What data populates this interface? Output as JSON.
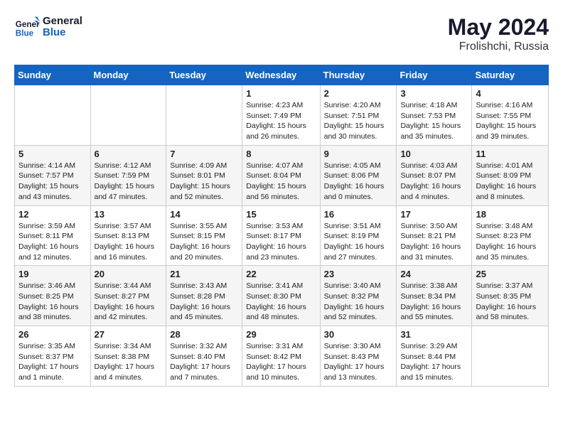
{
  "header": {
    "logo_line1": "General",
    "logo_line2": "Blue",
    "main_title": "May 2024",
    "subtitle": "Frolishchi, Russia"
  },
  "days_of_week": [
    "Sunday",
    "Monday",
    "Tuesday",
    "Wednesday",
    "Thursday",
    "Friday",
    "Saturday"
  ],
  "weeks": [
    [
      {
        "num": "",
        "detail": ""
      },
      {
        "num": "",
        "detail": ""
      },
      {
        "num": "",
        "detail": ""
      },
      {
        "num": "1",
        "detail": "Sunrise: 4:23 AM\nSunset: 7:49 PM\nDaylight: 15 hours\nand 26 minutes."
      },
      {
        "num": "2",
        "detail": "Sunrise: 4:20 AM\nSunset: 7:51 PM\nDaylight: 15 hours\nand 30 minutes."
      },
      {
        "num": "3",
        "detail": "Sunrise: 4:18 AM\nSunset: 7:53 PM\nDaylight: 15 hours\nand 35 minutes."
      },
      {
        "num": "4",
        "detail": "Sunrise: 4:16 AM\nSunset: 7:55 PM\nDaylight: 15 hours\nand 39 minutes."
      }
    ],
    [
      {
        "num": "5",
        "detail": "Sunrise: 4:14 AM\nSunset: 7:57 PM\nDaylight: 15 hours\nand 43 minutes."
      },
      {
        "num": "6",
        "detail": "Sunrise: 4:12 AM\nSunset: 7:59 PM\nDaylight: 15 hours\nand 47 minutes."
      },
      {
        "num": "7",
        "detail": "Sunrise: 4:09 AM\nSunset: 8:01 PM\nDaylight: 15 hours\nand 52 minutes."
      },
      {
        "num": "8",
        "detail": "Sunrise: 4:07 AM\nSunset: 8:04 PM\nDaylight: 15 hours\nand 56 minutes."
      },
      {
        "num": "9",
        "detail": "Sunrise: 4:05 AM\nSunset: 8:06 PM\nDaylight: 16 hours\nand 0 minutes."
      },
      {
        "num": "10",
        "detail": "Sunrise: 4:03 AM\nSunset: 8:07 PM\nDaylight: 16 hours\nand 4 minutes."
      },
      {
        "num": "11",
        "detail": "Sunrise: 4:01 AM\nSunset: 8:09 PM\nDaylight: 16 hours\nand 8 minutes."
      }
    ],
    [
      {
        "num": "12",
        "detail": "Sunrise: 3:59 AM\nSunset: 8:11 PM\nDaylight: 16 hours\nand 12 minutes."
      },
      {
        "num": "13",
        "detail": "Sunrise: 3:57 AM\nSunset: 8:13 PM\nDaylight: 16 hours\nand 16 minutes."
      },
      {
        "num": "14",
        "detail": "Sunrise: 3:55 AM\nSunset: 8:15 PM\nDaylight: 16 hours\nand 20 minutes."
      },
      {
        "num": "15",
        "detail": "Sunrise: 3:53 AM\nSunset: 8:17 PM\nDaylight: 16 hours\nand 23 minutes."
      },
      {
        "num": "16",
        "detail": "Sunrise: 3:51 AM\nSunset: 8:19 PM\nDaylight: 16 hours\nand 27 minutes."
      },
      {
        "num": "17",
        "detail": "Sunrise: 3:50 AM\nSunset: 8:21 PM\nDaylight: 16 hours\nand 31 minutes."
      },
      {
        "num": "18",
        "detail": "Sunrise: 3:48 AM\nSunset: 8:23 PM\nDaylight: 16 hours\nand 35 minutes."
      }
    ],
    [
      {
        "num": "19",
        "detail": "Sunrise: 3:46 AM\nSunset: 8:25 PM\nDaylight: 16 hours\nand 38 minutes."
      },
      {
        "num": "20",
        "detail": "Sunrise: 3:44 AM\nSunset: 8:27 PM\nDaylight: 16 hours\nand 42 minutes."
      },
      {
        "num": "21",
        "detail": "Sunrise: 3:43 AM\nSunset: 8:28 PM\nDaylight: 16 hours\nand 45 minutes."
      },
      {
        "num": "22",
        "detail": "Sunrise: 3:41 AM\nSunset: 8:30 PM\nDaylight: 16 hours\nand 48 minutes."
      },
      {
        "num": "23",
        "detail": "Sunrise: 3:40 AM\nSunset: 8:32 PM\nDaylight: 16 hours\nand 52 minutes."
      },
      {
        "num": "24",
        "detail": "Sunrise: 3:38 AM\nSunset: 8:34 PM\nDaylight: 16 hours\nand 55 minutes."
      },
      {
        "num": "25",
        "detail": "Sunrise: 3:37 AM\nSunset: 8:35 PM\nDaylight: 16 hours\nand 58 minutes."
      }
    ],
    [
      {
        "num": "26",
        "detail": "Sunrise: 3:35 AM\nSunset: 8:37 PM\nDaylight: 17 hours\nand 1 minute."
      },
      {
        "num": "27",
        "detail": "Sunrise: 3:34 AM\nSunset: 8:38 PM\nDaylight: 17 hours\nand 4 minutes."
      },
      {
        "num": "28",
        "detail": "Sunrise: 3:32 AM\nSunset: 8:40 PM\nDaylight: 17 hours\nand 7 minutes."
      },
      {
        "num": "29",
        "detail": "Sunrise: 3:31 AM\nSunset: 8:42 PM\nDaylight: 17 hours\nand 10 minutes."
      },
      {
        "num": "30",
        "detail": "Sunrise: 3:30 AM\nSunset: 8:43 PM\nDaylight: 17 hours\nand 13 minutes."
      },
      {
        "num": "31",
        "detail": "Sunrise: 3:29 AM\nSunset: 8:44 PM\nDaylight: 17 hours\nand 15 minutes."
      },
      {
        "num": "",
        "detail": ""
      }
    ]
  ]
}
